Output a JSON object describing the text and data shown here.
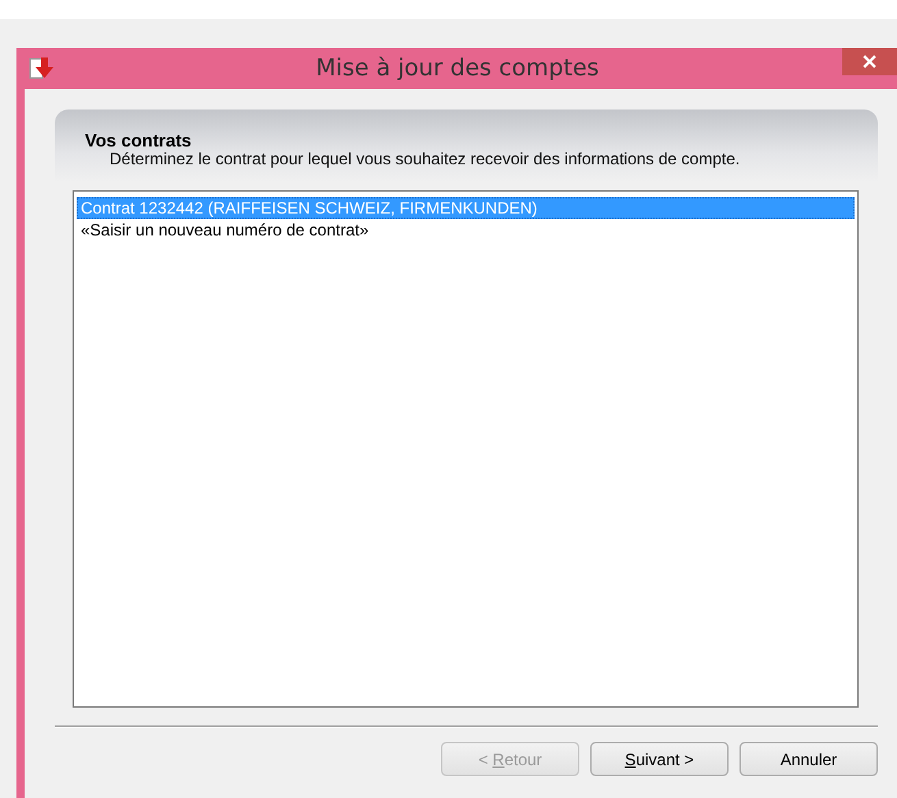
{
  "window": {
    "title": "Mise à jour des comptes"
  },
  "header": {
    "title": "Vos contrats",
    "description": "Déterminez le contrat pour lequel vous souhaitez recevoir des informations de compte."
  },
  "contracts": [
    {
      "label": "Contrat 1232442 (RAIFFEISEN SCHWEIZ, FIRMENKUNDEN)",
      "selected": true
    },
    {
      "label": "«Saisir un nouveau numéro de contrat»",
      "selected": false
    }
  ],
  "buttons": [
    {
      "prefix": "< ",
      "access_key": "R",
      "rest": "etour",
      "disabled": true
    },
    {
      "access_key": "S",
      "rest": "uivant >",
      "disabled": false
    },
    {
      "rest": "Annuler",
      "disabled": false
    }
  ]
}
